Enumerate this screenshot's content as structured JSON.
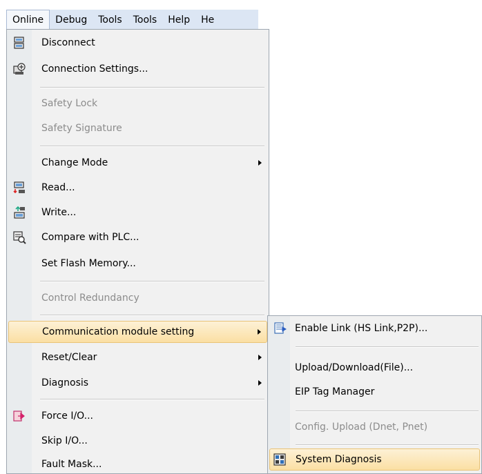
{
  "menubar": {
    "items": [
      {
        "label": "Online",
        "active": true
      },
      {
        "label": "Debug"
      },
      {
        "label": "Tools"
      },
      {
        "label": "Tools"
      },
      {
        "label": "Help"
      },
      {
        "label": "He"
      }
    ]
  },
  "online_menu": {
    "items": {
      "disconnect": {
        "label": "Disconnect",
        "icon": "disconnect-icon"
      },
      "connection_settings": {
        "label": "Connection Settings...",
        "icon": "connection-settings-icon"
      },
      "safety_lock": {
        "label": "Safety Lock",
        "disabled": true
      },
      "safety_signature": {
        "label": "Safety Signature",
        "disabled": true
      },
      "change_mode": {
        "label": "Change Mode",
        "submenu": true
      },
      "read": {
        "label": "Read...",
        "icon": "read-icon"
      },
      "write": {
        "label": "Write...",
        "icon": "write-icon"
      },
      "compare": {
        "label": "Compare with PLC...",
        "icon": "compare-icon"
      },
      "set_flash": {
        "label": "Set Flash Memory..."
      },
      "control_redundancy": {
        "label": "Control Redundancy",
        "disabled": true
      },
      "comm_module": {
        "label": "Communication module setting",
        "submenu": true,
        "highlighted": true
      },
      "reset_clear": {
        "label": "Reset/Clear",
        "submenu": true
      },
      "diagnosis": {
        "label": "Diagnosis",
        "submenu": true
      },
      "force_io": {
        "label": "Force I/O...",
        "icon": "force-io-icon"
      },
      "skip_io": {
        "label": "Skip I/O..."
      },
      "fault_mask": {
        "label": "Fault Mask..."
      }
    }
  },
  "comm_submenu": {
    "items": {
      "enable_link": {
        "label": "Enable Link (HS Link,P2P)...",
        "icon": "enable-link-icon"
      },
      "upload_download": {
        "label": "Upload/Download(File)..."
      },
      "eip_tag": {
        "label": "EIP Tag Manager"
      },
      "config_upload": {
        "label": "Config. Upload (Dnet, Pnet)",
        "disabled": true
      },
      "system_diagnosis": {
        "label": "System Diagnosis",
        "icon": "system-diagnosis-icon",
        "highlighted": true
      }
    }
  },
  "colors": {
    "menubar_bg": "#dce6f4",
    "menu_bg": "#f1f1f1",
    "highlight_bg": "#fbdfa3",
    "disabled_text": "#8c8c8c"
  }
}
